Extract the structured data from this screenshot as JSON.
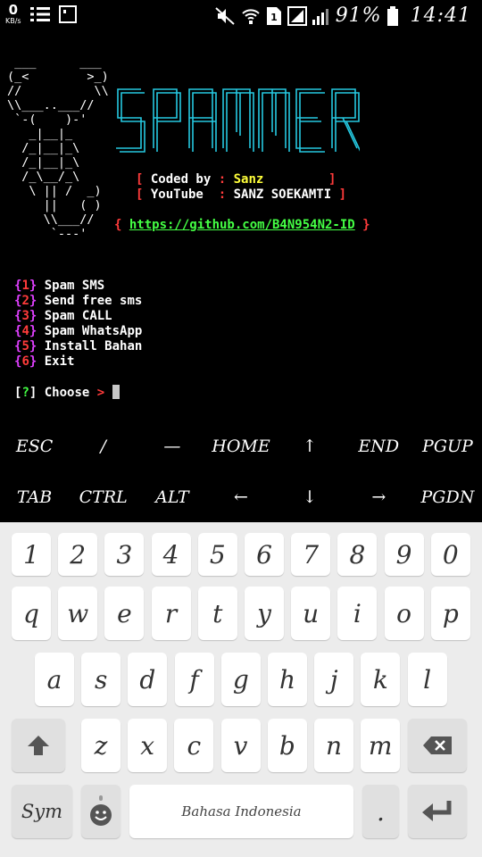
{
  "status_bar": {
    "net_speed": "0",
    "net_unit": "KB/s",
    "battery_percent": "91%",
    "time": "14:41",
    "icons": [
      "equalizer-icon",
      "screenshot-icon",
      "mute-icon",
      "wifi-icon",
      "sim-1-icon",
      "no-sim-signal-icon",
      "signal-icon",
      "battery-icon"
    ]
  },
  "terminal": {
    "logo_text": "SPAMMER",
    "logo_color": "#25c8e0",
    "ascii_art": [
      " ___      ___",
      "(_<        >_)",
      "//          \\\\",
      "\\\\___..___//",
      " `-(    )-'",
      "   _|__|_",
      "  /_|__|_\\",
      "  /_|__|_\\",
      "  /_\\__/_\\",
      "   \\ || /  _)",
      "     ||   ( )",
      "     \\\\___//",
      "      `---'"
    ],
    "info": {
      "coded_by_label": "Coded by",
      "coded_by_value": "Sanz",
      "youtube_label": "YouTube",
      "youtube_value": "SANZ SOEKAMTI",
      "link": "https://github.com/B4N954N2-ID"
    },
    "menu": [
      {
        "num": "1",
        "label": "Spam SMS"
      },
      {
        "num": "2",
        "label": "Send free sms"
      },
      {
        "num": "3",
        "label": "Spam CALL"
      },
      {
        "num": "4",
        "label": "Spam WhatsApp"
      },
      {
        "num": "5",
        "label": "Install Bahan"
      },
      {
        "num": "6",
        "label": "Exit"
      }
    ],
    "prompt_mark": "?",
    "prompt_label": "Choose",
    "prompt_arrow": ">"
  },
  "extra_keys": {
    "row1": [
      "ESC",
      "/",
      "—",
      "HOME",
      "↑",
      "END",
      "PGUP"
    ],
    "row2": [
      "TAB",
      "CTRL",
      "ALT",
      "←",
      "↓",
      "→",
      "PGDN"
    ]
  },
  "keyboard": {
    "numbers": [
      "1",
      "2",
      "3",
      "4",
      "5",
      "6",
      "7",
      "8",
      "9",
      "0"
    ],
    "row1": [
      "q",
      "w",
      "e",
      "r",
      "t",
      "y",
      "u",
      "i",
      "o",
      "p"
    ],
    "row2": [
      "a",
      "s",
      "d",
      "f",
      "g",
      "h",
      "j",
      "k",
      "l"
    ],
    "row3": [
      "z",
      "x",
      "c",
      "v",
      "b",
      "n",
      "m"
    ],
    "sym_label": "Sym",
    "space_label": "Bahasa Indonesia",
    "period_label": "."
  }
}
